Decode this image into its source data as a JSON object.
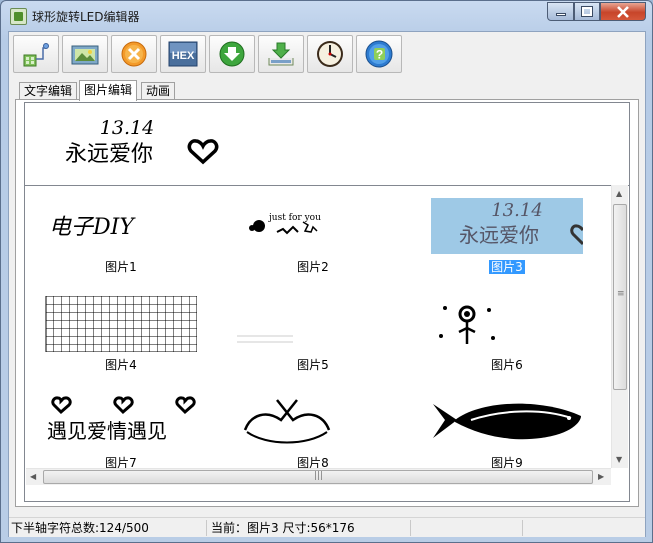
{
  "window": {
    "title": "球形旋转LED编辑器",
    "controls": [
      "minimize",
      "maximize",
      "close"
    ]
  },
  "toolbar": {
    "buttons": [
      {
        "icon": "new-display-icon"
      },
      {
        "icon": "open-image-icon"
      },
      {
        "icon": "delete-icon"
      },
      {
        "icon": "hex-export-icon",
        "text": "HEX"
      },
      {
        "icon": "download-icon"
      },
      {
        "icon": "save-icon"
      },
      {
        "icon": "clock-icon"
      },
      {
        "icon": "help-icon",
        "text": "?"
      }
    ]
  },
  "tabs": [
    {
      "label": "文字编辑",
      "active": false
    },
    {
      "label": "图片编辑",
      "active": true
    },
    {
      "label": "动画",
      "active": false
    }
  ],
  "preview": {
    "line1": "13.14",
    "line2": "永远爱你"
  },
  "thumbnails": [
    {
      "label": "图片1",
      "art": "电子DIY"
    },
    {
      "label": "图片2",
      "art": "just for you"
    },
    {
      "label": "图片3",
      "art_line1": "13.14",
      "art_line2": "永远爱你",
      "selected": true
    },
    {
      "label": "图片4",
      "art": "grid"
    },
    {
      "label": "图片5",
      "art": ""
    },
    {
      "label": "图片6",
      "art": "flower"
    },
    {
      "label": "图片7",
      "art": "遇见爱情遇见"
    },
    {
      "label": "图片8",
      "art": "hands"
    },
    {
      "label": "图片9",
      "art": "fish"
    }
  ],
  "statusbar": {
    "total": "下半轴字符总数:124/500",
    "current": "当前：图片3 尺寸:56*176",
    "extra": ""
  },
  "colors": {
    "selection": "#3399ff",
    "selected_bg": "#9ec9e6",
    "title_bar": "#c9daf0"
  }
}
